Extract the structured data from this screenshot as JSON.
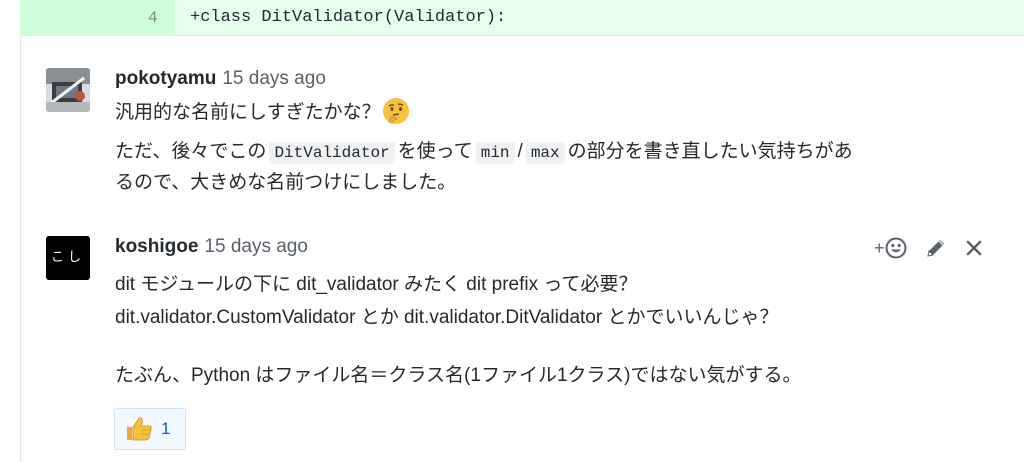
{
  "diff": {
    "line_number": "4",
    "code": "+class DitValidator(Validator):"
  },
  "comments": [
    {
      "author": "pokotyamu",
      "time": "15 days ago",
      "line1_text": "汎用的な名前にしすぎたかな？",
      "line1_emoji": "thinking-face",
      "line2_a": "ただ、後々でこの",
      "line2_code1": "DitValidator",
      "line2_b": "を使って",
      "line2_code2": "min",
      "line2_c": "/",
      "line2_code3": "max",
      "line2_d": "の部分を書き直したい気持ちがあ",
      "line3": "るので、大きめな名前つけにしました。"
    },
    {
      "author": "koshigoe",
      "time": "15 days ago",
      "avatar_text": "こし",
      "line1": "dit モジュールの下に dit_validator みたく dit prefix って必要？",
      "line2": "dit.validator.CustomValidator とか dit.validator.DitValidator とかでいいんじゃ？",
      "line3": "たぶん、Python はファイル名＝クラス名(1ファイル1クラス)ではない気がする。",
      "actions": {
        "reaction_add_label": "+",
        "reaction_icon": "smiley-icon",
        "edit_icon": "pencil-icon",
        "delete_icon": "close-icon"
      },
      "reaction": {
        "icon": "thumbs-up-icon",
        "count": "1"
      }
    }
  ],
  "colors": {
    "diff_added_bg": "#e6ffed",
    "diff_num_bg": "#cdffd8",
    "reaction_bg": "#f1f8ff",
    "reaction_border": "#c8e1ff",
    "link_blue": "#0366d6"
  }
}
